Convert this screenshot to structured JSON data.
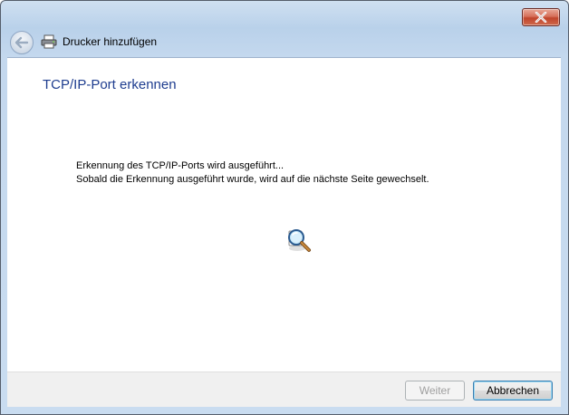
{
  "window": {
    "title": "Drucker hinzufügen",
    "close_label": "Schließen"
  },
  "content": {
    "heading": "TCP/IP-Port erkennen",
    "message_line1": "Erkennung des TCP/IP-Ports wird ausgeführt...",
    "message_line2": "Sobald die Erkennung ausgeführt wurde, wird auf die nächste Seite gewechselt."
  },
  "footer": {
    "next_label": "Weiter",
    "cancel_label": "Abbrechen"
  },
  "icons": {
    "back": "back-arrow-icon",
    "printer": "printer-icon",
    "search": "magnifier-search-icon",
    "close": "close-icon"
  }
}
